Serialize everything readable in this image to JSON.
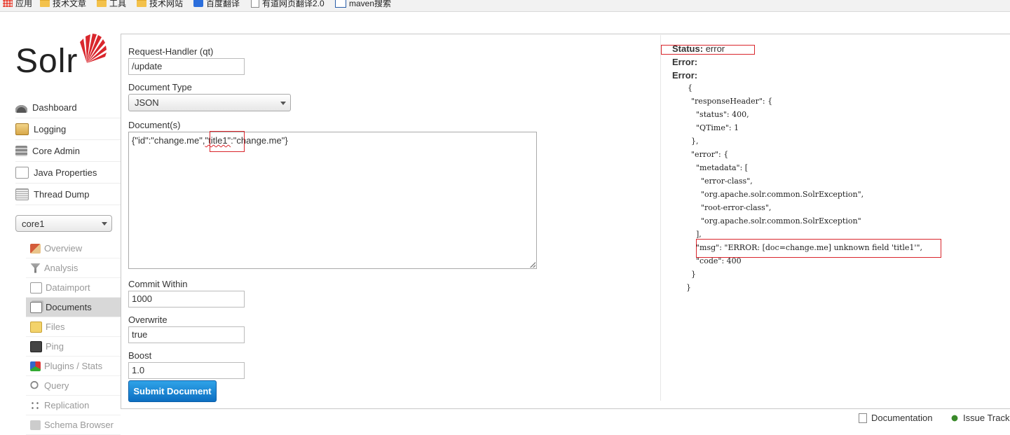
{
  "bookmarks": [
    {
      "label": "应用",
      "icon": "apps-grid-icon"
    },
    {
      "label": "技术文章",
      "icon": "folder-icon"
    },
    {
      "label": "工具",
      "icon": "folder-icon"
    },
    {
      "label": "技术网站",
      "icon": "folder-icon"
    },
    {
      "label": "百度翻译",
      "icon": "baidu-translate-icon"
    },
    {
      "label": "有道网页翻译2.0",
      "icon": "page-icon"
    },
    {
      "label": "maven搜索",
      "icon": "maven-icon"
    }
  ],
  "logo": {
    "text": "Solr",
    "accent": "#d9262c"
  },
  "nav": [
    {
      "label": "Dashboard",
      "icon": "dashboard-icon"
    },
    {
      "label": "Logging",
      "icon": "logging-icon"
    },
    {
      "label": "Core Admin",
      "icon": "core-admin-icon"
    },
    {
      "label": "Java Properties",
      "icon": "java-properties-icon"
    },
    {
      "label": "Thread Dump",
      "icon": "thread-dump-icon"
    }
  ],
  "core_selector": {
    "value": "core1"
  },
  "core_nav": [
    {
      "label": "Overview",
      "icon": "overview-icon"
    },
    {
      "label": "Analysis",
      "icon": "analysis-icon"
    },
    {
      "label": "Dataimport",
      "icon": "dataimport-icon"
    },
    {
      "label": "Documents",
      "icon": "documents-icon",
      "active": true
    },
    {
      "label": "Files",
      "icon": "files-icon"
    },
    {
      "label": "Ping",
      "icon": "ping-icon"
    },
    {
      "label": "Plugins / Stats",
      "icon": "plugins-icon"
    },
    {
      "label": "Query",
      "icon": "query-icon"
    },
    {
      "label": "Replication",
      "icon": "replication-icon"
    },
    {
      "label": "Schema Browser",
      "icon": "schema-icon"
    }
  ],
  "form": {
    "request_handler_label": "Request-Handler (qt)",
    "request_handler_value": "/update",
    "document_type_label": "Document Type",
    "document_type_value": "JSON",
    "documents_label": "Document(s)",
    "doc_part1": "{\"id\":\"change.me\",",
    "doc_part2": "\"title1\"",
    "doc_part3": ":\"change.me\"}",
    "commit_within_label": "Commit Within",
    "commit_within_value": "1000",
    "overwrite_label": "Overwrite",
    "overwrite_value": "true",
    "boost_label": "Boost",
    "boost_value": "1.0",
    "submit_label": "Submit Document"
  },
  "response": {
    "status_label": "Status:",
    "status_value": "error",
    "error_label1": "Error:",
    "error_label2": "Error:",
    "json_lines": [
      "{",
      "  \"responseHeader\": {",
      "    \"status\": 400,",
      "    \"QTime\": 1",
      "  },",
      "  \"error\": {",
      "    \"metadata\": [",
      "      \"error-class\",",
      "      \"org.apache.solr.common.SolrException\",",
      "      \"root-error-class\",",
      "      \"org.apache.solr.common.SolrException\"",
      "    ],",
      "    \"msg\": \"ERROR: [doc=change.me] unknown field 'title1'\",",
      "    \"code\": 400",
      "  }",
      "}"
    ]
  },
  "footer": {
    "documentation": "Documentation",
    "issue_tracker": "Issue Track"
  }
}
